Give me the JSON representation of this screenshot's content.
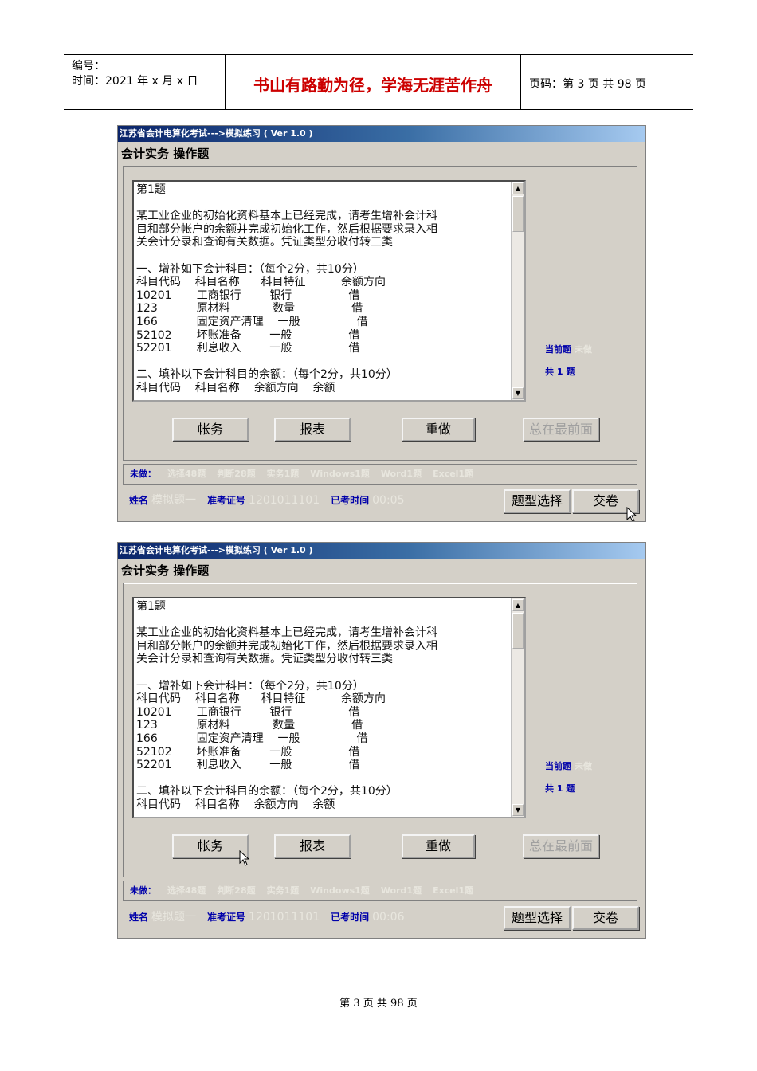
{
  "header": {
    "serial_label": "编号：",
    "time_label": "时间：2021 年 x 月 x 日",
    "motto": "书山有路勤为径，学海无涯苦作舟",
    "page_label": "页码：第 3 页  共 98 页"
  },
  "screenshots": [
    {
      "title_bar": "江苏省会计电算化考试--->模拟练习 ( Ver 1.0 )",
      "window_title": "会计实务 操作题",
      "question_text": "第1题\n\n某工业企业的初始化资料基本上已经完成，请考生增补会计科\n目和部分帐户的余额并完成初始化工作，然后根据要求录入相\n关会计分录和查询有关数据。凭证类型分收付转三类\n\n一、增补如下会计科目：（每个2分，共10分）\n科目代码    科目名称      科目特征          余额方向\n10201       工商银行        银行                借\n123           原材料            数量                借\n166           固定资产清理    一般                借\n52102       坏账准备        一般                借\n52201       利息收入        一般                借\n\n二、填补以下会计科目的余额：（每个2分，共10分）\n科目代码    科目名称    余额方向    余额",
      "current_label": "当前题",
      "current_status": "未做",
      "total_label": "共 1 题",
      "buttons": {
        "accounts": "帐务",
        "reports": "报表",
        "redo": "重做",
        "always_on_top": "总在最前面"
      },
      "status_line": [
        "未做：",
        "选择48题",
        "判断28题",
        "实务1题",
        "Windows1题",
        "Word1题",
        "Excel1题"
      ],
      "name_label": "姓名",
      "name_value": "模拟题一",
      "exam_id_label": "准考证号",
      "exam_id_value": "1201011101",
      "elapsed_label": "已考时间",
      "elapsed_value": "00:05",
      "type_select_button": "题型选择",
      "submit_button": "交卷"
    },
    {
      "title_bar": "江苏省会计电算化考试--->模拟练习 ( Ver 1.0 )",
      "window_title": "会计实务 操作题",
      "question_text": "第1题\n\n某工业企业的初始化资料基本上已经完成，请考生增补会计科\n目和部分帐户的余额并完成初始化工作，然后根据要求录入相\n关会计分录和查询有关数据。凭证类型分收付转三类\n\n一、增补如下会计科目：（每个2分，共10分）\n科目代码    科目名称      科目特征          余额方向\n10201       工商银行        银行                借\n123           原材料            数量                借\n166           固定资产清理    一般                借\n52102       坏账准备        一般                借\n52201       利息收入        一般                借\n\n二、填补以下会计科目的余额：（每个2分，共10分）\n科目代码    科目名称    余额方向    余额",
      "current_label": "当前题",
      "current_status": "未做",
      "total_label": "共 1 题",
      "buttons": {
        "accounts": "帐务",
        "reports": "报表",
        "redo": "重做",
        "always_on_top": "总在最前面"
      },
      "status_line": [
        "未做：",
        "选择48题",
        "判断28题",
        "实务1题",
        "Windows1题",
        "Word1题",
        "Excel1题"
      ],
      "name_label": "姓名",
      "name_value": "模拟题一",
      "exam_id_label": "准考证号",
      "exam_id_value": "1201011101",
      "elapsed_label": "已考时间",
      "elapsed_value": "00:06",
      "type_select_button": "题型选择",
      "submit_button": "交卷"
    }
  ],
  "footer": "第 3 页  共 98 页"
}
